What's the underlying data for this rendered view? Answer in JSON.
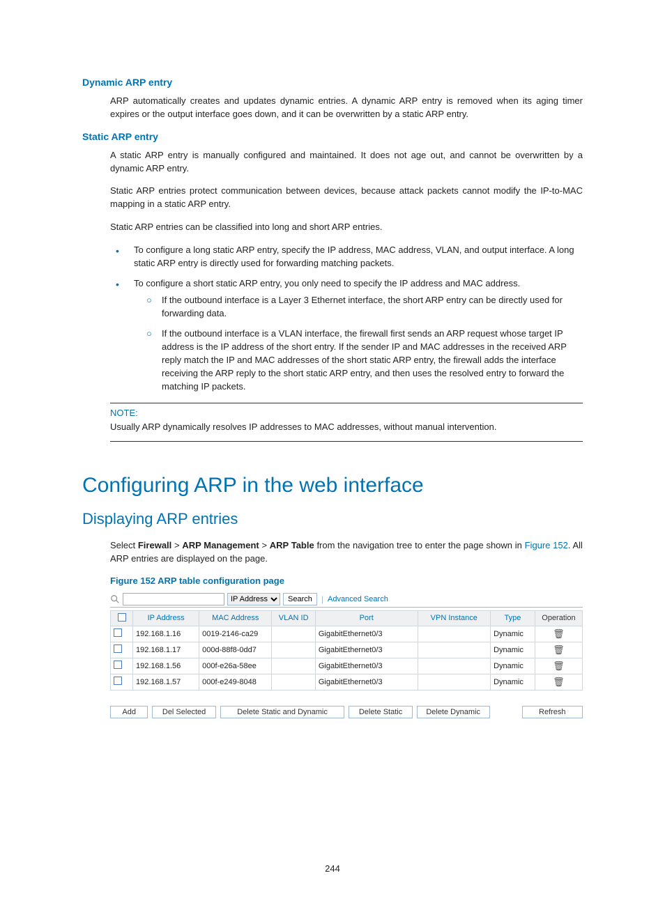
{
  "sections": {
    "dynamic_title": "Dynamic ARP entry",
    "dynamic_body": "ARP automatically creates and updates dynamic entries. A dynamic ARP entry is removed when its aging timer expires or the output interface goes down, and it can be overwritten by a static ARP entry.",
    "static_title": "Static ARP entry",
    "static_p1": "A static ARP entry is manually configured and maintained. It does not age out, and cannot be overwritten by a dynamic ARP entry.",
    "static_p2": "Static ARP entries protect communication between devices, because attack packets cannot modify the IP-to-MAC mapping in a static ARP entry.",
    "static_p3": "Static ARP entries can be classified into long and short ARP entries.",
    "bullet1": "To configure a long static ARP entry, specify the IP address, MAC address, VLAN, and output interface. A long static ARP entry is directly used for forwarding matching packets.",
    "bullet2": "To configure a short static ARP entry, you only need to specify the IP address and MAC address.",
    "sub1": "If the outbound interface is a Layer 3 Ethernet interface, the short ARP entry can be directly used for forwarding data.",
    "sub2": "If the outbound interface is a VLAN interface, the firewall first sends an ARP request whose target IP address is the IP address of the short entry. If the sender IP and MAC addresses in the received ARP reply match the IP and MAC addresses of the short static ARP entry, the firewall adds the interface receiving the ARP reply to the short static ARP entry, and then uses the resolved entry to forward the matching IP packets."
  },
  "note": {
    "label": "NOTE:",
    "body": "Usually ARP dynamically resolves IP addresses to MAC addresses, without manual intervention."
  },
  "h1": "Configuring ARP in the web interface",
  "h2": "Displaying ARP entries",
  "nav_text": {
    "prefix": "Select ",
    "b1": "Firewall",
    "sep": " > ",
    "b2": "ARP Management",
    "b3": "ARP Table",
    "suffix1": " from the navigation tree to enter the page shown in ",
    "figref": "Figure 152",
    "suffix2": ". All ARP entries are displayed on the page."
  },
  "fig_caption": "Figure 152 ARP table configuration page",
  "searchbar": {
    "field_option": "IP Address",
    "search_btn": "Search",
    "adv_link": "Advanced Search"
  },
  "table": {
    "headers": {
      "ip": "IP Address",
      "mac": "MAC Address",
      "vlan": "VLAN ID",
      "port": "Port",
      "vpn": "VPN Instance",
      "type": "Type",
      "op": "Operation"
    },
    "rows": [
      {
        "ip": "192.168.1.16",
        "mac": "0019-2146-ca29",
        "vlan": "",
        "port": "GigabitEthernet0/3",
        "vpn": "",
        "type": "Dynamic"
      },
      {
        "ip": "192.168.1.17",
        "mac": "000d-88f8-0dd7",
        "vlan": "",
        "port": "GigabitEthernet0/3",
        "vpn": "",
        "type": "Dynamic"
      },
      {
        "ip": "192.168.1.56",
        "mac": "000f-e26a-58ee",
        "vlan": "",
        "port": "GigabitEthernet0/3",
        "vpn": "",
        "type": "Dynamic"
      },
      {
        "ip": "192.168.1.57",
        "mac": "000f-e249-8048",
        "vlan": "",
        "port": "GigabitEthernet0/3",
        "vpn": "",
        "type": "Dynamic"
      }
    ]
  },
  "buttons": {
    "add": "Add",
    "del_selected": "Del Selected",
    "del_all": "Delete Static and Dynamic",
    "del_static": "Delete Static",
    "del_dynamic": "Delete Dynamic",
    "refresh": "Refresh"
  },
  "page_number": "244"
}
